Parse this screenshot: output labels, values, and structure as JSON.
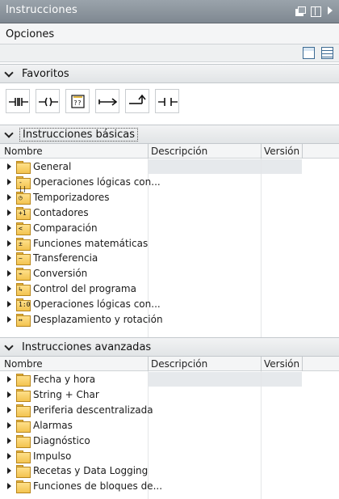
{
  "panel": {
    "title": "Instrucciones"
  },
  "options": {
    "label": "Opciones"
  },
  "favorites": {
    "title": "Favoritos",
    "items": [
      {
        "icon": "normally-open-contact-icon"
      },
      {
        "icon": "coil-icon"
      },
      {
        "icon": "empty-box-icon",
        "text": "??"
      },
      {
        "icon": "open-branch-icon"
      },
      {
        "icon": "close-branch-icon"
      },
      {
        "icon": "normally-open-contact-icon-2"
      }
    ]
  },
  "basic": {
    "title": "Instrucciones básicas",
    "columns": [
      "Nombre",
      "Descripción",
      "Versión"
    ],
    "rows": [
      {
        "label": "General",
        "sym": ""
      },
      {
        "label": "Operaciones lógicas con...",
        "sym": "-||"
      },
      {
        "label": "Temporizadores",
        "sym": "◷"
      },
      {
        "label": "Contadores",
        "sym": "+1"
      },
      {
        "label": "Comparación",
        "sym": "<"
      },
      {
        "label": "Funciones matemáticas",
        "sym": "±"
      },
      {
        "label": "Transferencia",
        "sym": "~"
      },
      {
        "label": "Conversión",
        "sym": "⌁"
      },
      {
        "label": "Control del programa",
        "sym": "↳"
      },
      {
        "label": "Operaciones lógicas con...",
        "sym": "1:0"
      },
      {
        "label": "Desplazamiento y rotación",
        "sym": "↔"
      }
    ]
  },
  "advanced": {
    "title": "Instrucciones avanzadas",
    "columns": [
      "Nombre",
      "Descripción",
      "Versión"
    ],
    "rows": [
      {
        "label": "Fecha y hora"
      },
      {
        "label": "String + Char"
      },
      {
        "label": "Periferia descentralizada"
      },
      {
        "label": "Alarmas"
      },
      {
        "label": "Diagnóstico"
      },
      {
        "label": "Impulso"
      },
      {
        "label": "Recetas y Data Logging"
      },
      {
        "label": "Funciones de bloques de..."
      }
    ]
  }
}
